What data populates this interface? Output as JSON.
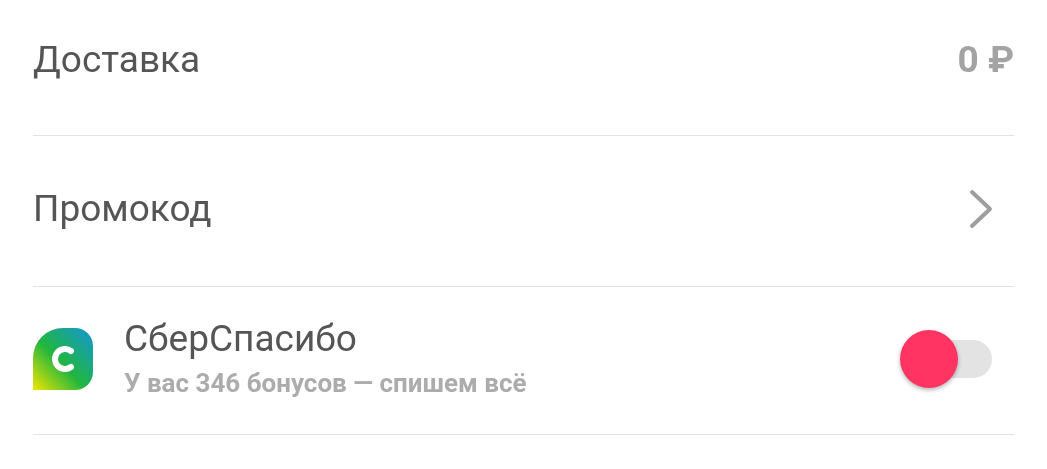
{
  "rows": [
    {
      "kind": "value",
      "label": "Доставка",
      "value": "0 ₽"
    },
    {
      "kind": "link",
      "label": "Промокод"
    },
    {
      "kind": "toggle",
      "label": "СберСпасибо",
      "subtitle": "У вас 346 бонусов — спишем всё",
      "on": false
    }
  ]
}
